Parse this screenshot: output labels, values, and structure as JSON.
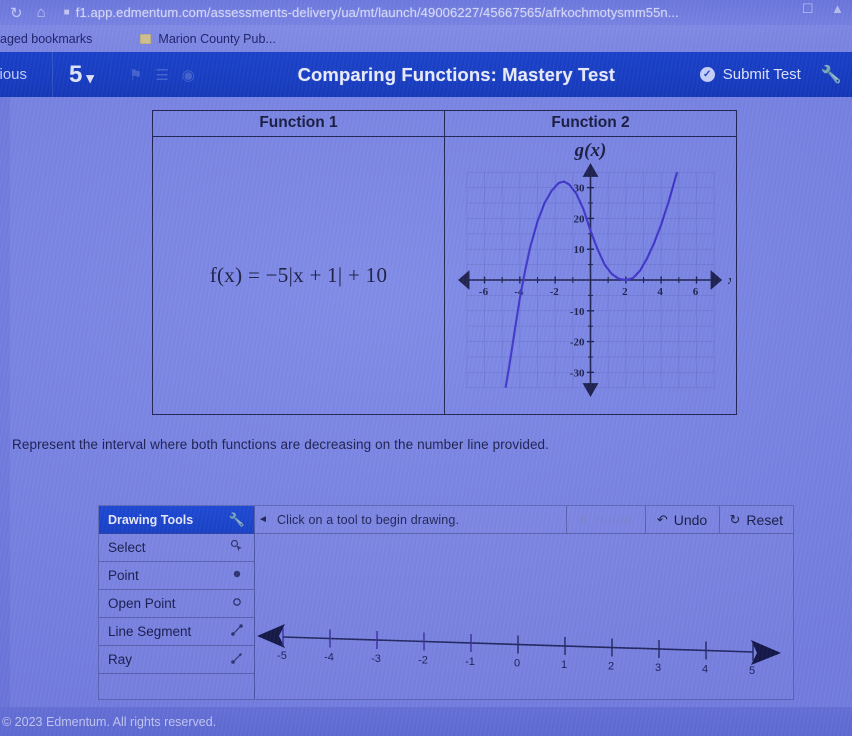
{
  "browser": {
    "reload_icon": "reload-icon",
    "home_icon": "home-icon",
    "lock_icon": "site-info-icon",
    "url": "f1.app.edmentum.com/assessments-delivery/ua/mt/launch/49006227/45667565/afrkochmotysmm55n...",
    "right_icons": [
      "cast-icon",
      "profile-icon"
    ],
    "bookmarks": {
      "managed_label": "aged bookmarks",
      "items": [
        {
          "label": "Marion County Pub...",
          "icon": "folder-icon"
        }
      ]
    }
  },
  "appbar": {
    "previous_label": "vious",
    "question_number": "5",
    "chevron": "⌄",
    "faint_icons": [
      "flag-icon",
      "bookmark-icon",
      "help-icon"
    ],
    "title": "Comparing Functions: Mastery Test",
    "submit_label": "Submit Test",
    "submit_icon": "check-circle-icon",
    "tool_icon": "wrench-icon"
  },
  "main": {
    "table": {
      "headers": [
        "Function 1",
        "Function 2"
      ],
      "function1_equation": "f(x) = −5|x + 1| + 10",
      "function2_label": "g(x)"
    },
    "instruction": "Represent the interval where both functions are decreasing on the number line provided."
  },
  "chart_data": {
    "type": "line",
    "title": "g(x)",
    "xlabel": "x",
    "ylabel": "",
    "xlim": [
      -7.5,
      7.5
    ],
    "ylim": [
      -38,
      38
    ],
    "xticks": [
      -6,
      -4,
      -2,
      2,
      4,
      6
    ],
    "yticks": [
      30,
      20,
      10,
      -10,
      -20,
      -30
    ],
    "xtick_labels": [
      "-6",
      "-4",
      "-2",
      "2",
      "4",
      "6"
    ],
    "ytick_labels": [
      "30",
      "20",
      "10",
      "-10",
      "-20",
      "-30"
    ],
    "grid": true,
    "legend": "none",
    "axis_arrows": true,
    "series": [
      {
        "name": "g(x)",
        "color": "#3a30c8",
        "description": "cubic with x-intercept near x = -4, local maximum near (-1.5, 32), local minimum touching x-axis at (2, 0), rising steeply after x = 2",
        "points": [
          [
            -4.9,
            -38
          ],
          [
            -4.6,
            -28
          ],
          [
            -4.3,
            -17
          ],
          [
            -4.0,
            -6
          ],
          [
            -3.7,
            3
          ],
          [
            -3.4,
            11
          ],
          [
            -3.0,
            19
          ],
          [
            -2.6,
            25
          ],
          [
            -2.2,
            29
          ],
          [
            -1.8,
            31.5
          ],
          [
            -1.5,
            32
          ],
          [
            -1.2,
            31
          ],
          [
            -0.8,
            28
          ],
          [
            -0.4,
            23
          ],
          [
            0.0,
            16
          ],
          [
            0.4,
            10
          ],
          [
            0.8,
            5
          ],
          [
            1.2,
            2
          ],
          [
            1.6,
            0.4
          ],
          [
            2.0,
            0
          ],
          [
            2.4,
            0.6
          ],
          [
            2.8,
            3
          ],
          [
            3.2,
            7
          ],
          [
            3.6,
            12
          ],
          [
            4.0,
            18
          ],
          [
            4.4,
            25
          ],
          [
            4.8,
            33
          ],
          [
            5.1,
            39
          ]
        ]
      }
    ]
  },
  "drawing_tools": {
    "panel_title": "Drawing Tools",
    "panel_icon": "wrench-icon",
    "collapse_icon": "collapse-left-icon",
    "items": [
      {
        "label": "Select",
        "icon": "cursor-icon"
      },
      {
        "label": "Point",
        "icon": "filled-point-icon"
      },
      {
        "label": "Open Point",
        "icon": "open-point-icon"
      },
      {
        "label": "Line Segment",
        "icon": "line-segment-icon"
      },
      {
        "label": "Ray",
        "icon": "ray-icon"
      }
    ],
    "hint": "Click on a tool to begin drawing.",
    "buttons": [
      {
        "label": "Delete",
        "icon": "delete-icon",
        "enabled": false
      },
      {
        "label": "Undo",
        "icon": "undo-icon",
        "enabled": true
      },
      {
        "label": "Reset",
        "icon": "reset-icon",
        "enabled": true
      }
    ]
  },
  "number_line": {
    "min": -5,
    "max": 5,
    "ticks": [
      -5,
      -4,
      -3,
      -2,
      -1,
      0,
      1,
      2,
      3,
      4,
      5
    ],
    "labels": [
      "-5",
      "-4",
      "-3",
      "-2",
      "-1",
      "0",
      "1",
      "2",
      "3",
      "4",
      "5"
    ],
    "left_arrow": true,
    "right_arrow": true
  },
  "footer": {
    "copyright": "© 2023 Edmentum. All rights reserved."
  },
  "colors": {
    "page_bg": "#7a86e6",
    "appbar": "#1540cc",
    "curve": "#3a30c8",
    "text": "#171b48",
    "grid": "#6a74cf"
  }
}
